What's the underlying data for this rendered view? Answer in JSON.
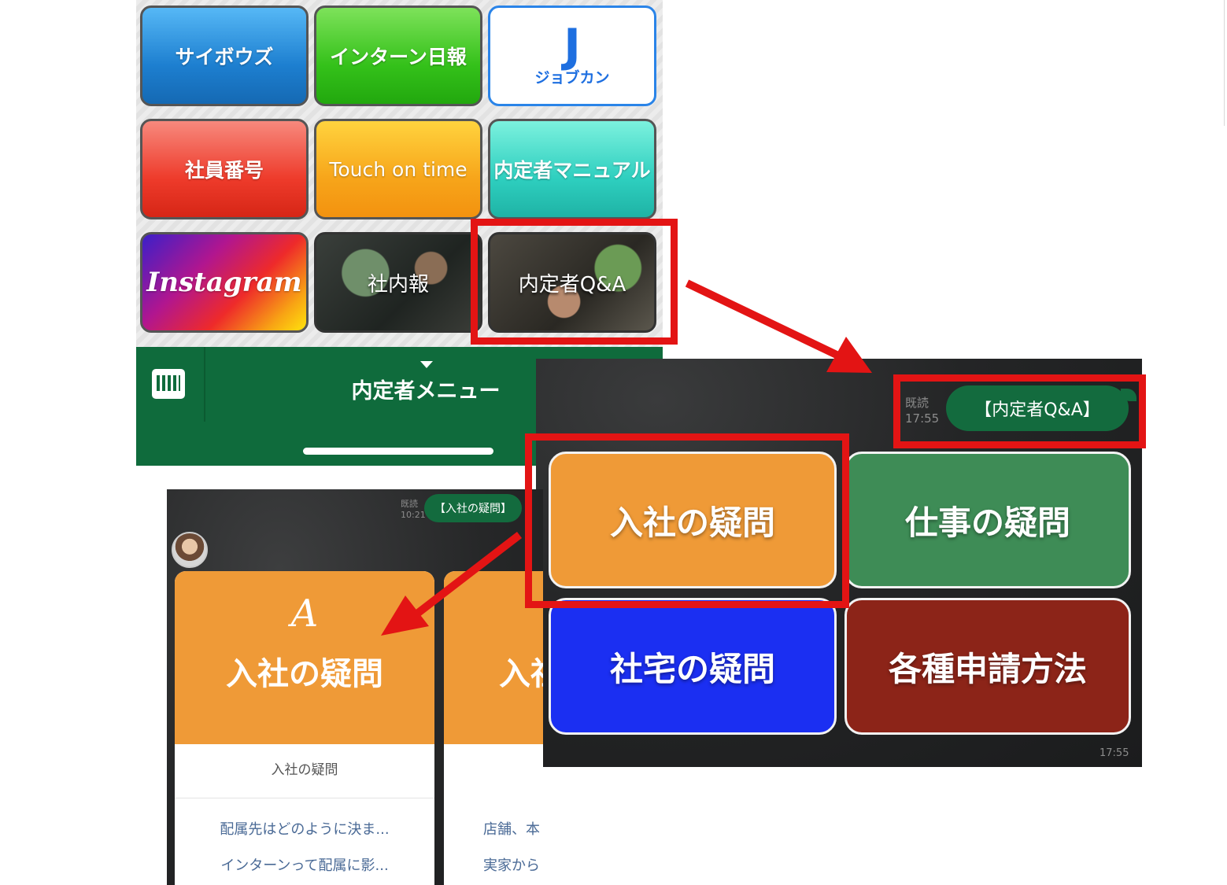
{
  "rich_menu": {
    "buttons": {
      "cybozu": "サイボウズ",
      "intern_report": "インターン日報",
      "jobcan_logo": "J",
      "jobcan_name": "ジョブカン",
      "employee_number": "社員番号",
      "touch_on_time": "Touch on time",
      "naitei_manual": "内定者マニュアル",
      "instagram": "Instagram",
      "company_news": "社内報",
      "naitei_qa": "内定者Q&A"
    },
    "menu_title": "内定者メニュー"
  },
  "chat_right": {
    "read_label": "既読",
    "read_time": "17:55",
    "bubble_text": "【内定者Q&A】",
    "cards": {
      "nyusha": "入社の疑問",
      "shigoto": "仕事の疑問",
      "shataku": "社宅の疑問",
      "shinsei": "各種申請方法"
    },
    "message_time": "17:55"
  },
  "chat_left": {
    "read_label": "既読",
    "read_time": "10:21",
    "bubble_text": "【入社の疑問】",
    "carousel": [
      {
        "monogram": "A",
        "title": "入社の疑問",
        "subtitle": "入社の疑問",
        "questions": [
          "配属先はどのように決ま...",
          "インターンって配属に影..."
        ]
      },
      {
        "title": "入社",
        "questions": [
          "店舗、本",
          "実家から"
        ]
      }
    ]
  },
  "colors": {
    "highlight": "#e31414",
    "line_green": "#136b3e",
    "menu_bar_green": "#0f6b3c",
    "nyusha_orange": "#ef9a37",
    "shigoto_green": "#3e8c56",
    "shataku_blue": "#1b2ff2",
    "shinsei_red": "#8c2418"
  },
  "icons": {
    "keyboard": "keyboard-icon",
    "menu_toggle": "caret-down-icon"
  }
}
